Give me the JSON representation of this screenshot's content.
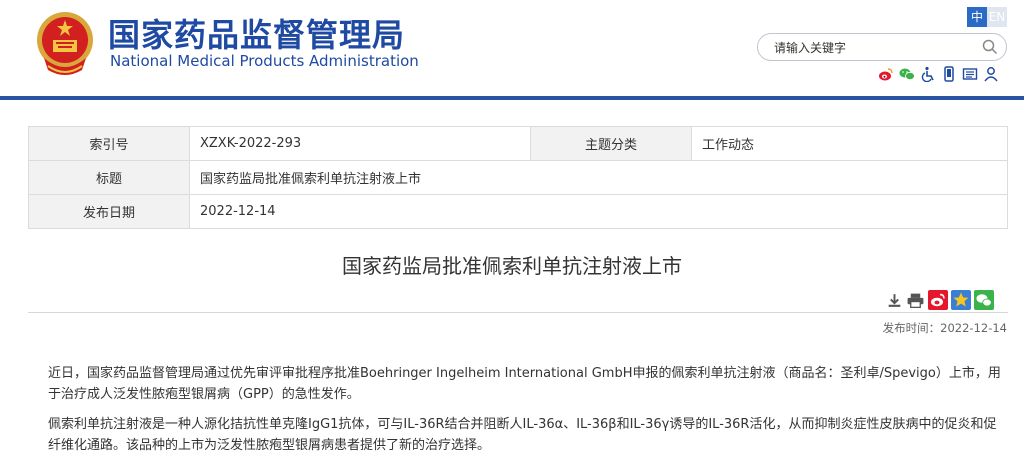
{
  "header": {
    "title_cn": "国家药品监督管理局",
    "title_en": "National Medical Products Administration",
    "lang": {
      "cn": "中",
      "en": "EN"
    },
    "search": {
      "placeholder": "请输入关键字"
    },
    "tools": [
      "weibo-icon",
      "wechat-icon",
      "accessibility-icon",
      "mobile-icon",
      "mail-icon",
      "user-icon"
    ]
  },
  "info": {
    "index_label": "索引号",
    "index_value": "XZXK-2022-293",
    "category_label": "主题分类",
    "category_value": "工作动态",
    "title_label": "标题",
    "title_value": "国家药监局批准佩索利单抗注射液上市",
    "date_label": "发布日期",
    "date_value": "2022-12-14"
  },
  "article": {
    "title": "国家药监局批准佩索利单抗注射液上市",
    "pubtime": "发布时间：2022-12-14",
    "paragraphs": [
      "近日，国家药品监督管理局通过优先审评审批程序批准Boehringer Ingelheim International GmbH申报的佩索利单抗注射液（商品名：圣利卓/Spevigo）上市，用于治疗成人泛发性脓疱型银屑病（GPP）的急性发作。",
      "佩索利单抗注射液是一种人源化拮抗性单克隆IgG1抗体，可与IL-36R结合并阻断人IL-36α、IL-36β和IL-36γ诱导的IL-36R活化，从而抑制炎症性皮肤病中的促炎和促纤维化通路。该品种的上市为泛发性脓疱型银屑病患者提供了新的治疗选择。"
    ]
  },
  "colors": {
    "brand": "#1f4aa3",
    "rule": "#2a54a3"
  }
}
